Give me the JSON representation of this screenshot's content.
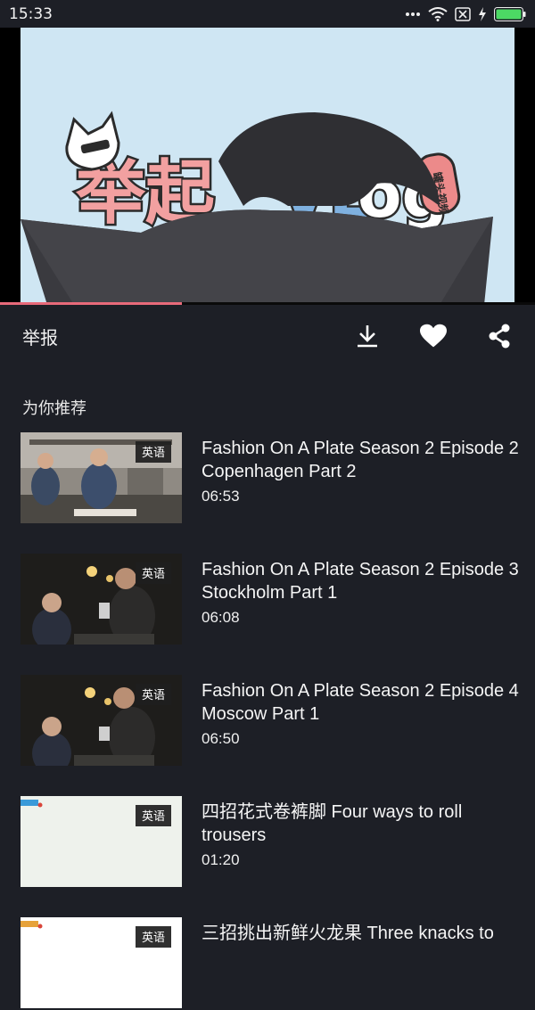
{
  "status_bar": {
    "time": "15:33"
  },
  "video": {
    "progress_fraction": 0.34,
    "thumbnail_title_text": "举起 VLog",
    "thumbnail_tag": "罐头视频"
  },
  "actions": {
    "report_label": "举报",
    "download_icon": "download-icon",
    "like_icon": "heart-icon",
    "share_icon": "share-icon"
  },
  "recommend": {
    "section_title": "为你推荐",
    "items": [
      {
        "badge": "英语",
        "title": "Fashion On A Plate Season 2 Episode 2 Copenhagen Part 2",
        "duration": "06:53",
        "thumb": "kitchen"
      },
      {
        "badge": "英语",
        "title": "Fashion On A Plate Season 2 Episode 3 Stockholm Part 1",
        "duration": "06:08",
        "thumb": "dark"
      },
      {
        "badge": "英语",
        "title": "Fashion On A Plate Season 2 Episode 4 Moscow Part 1",
        "duration": "06:50",
        "thumb": "dark"
      },
      {
        "badge": "英语",
        "title": "四招花式卷裤脚 Four ways to roll trousers",
        "duration": "01:20",
        "thumb": "light"
      },
      {
        "badge": "英语",
        "title": "三招挑出新鲜火龙果 Three knacks to",
        "duration": "",
        "thumb": "white"
      }
    ]
  }
}
